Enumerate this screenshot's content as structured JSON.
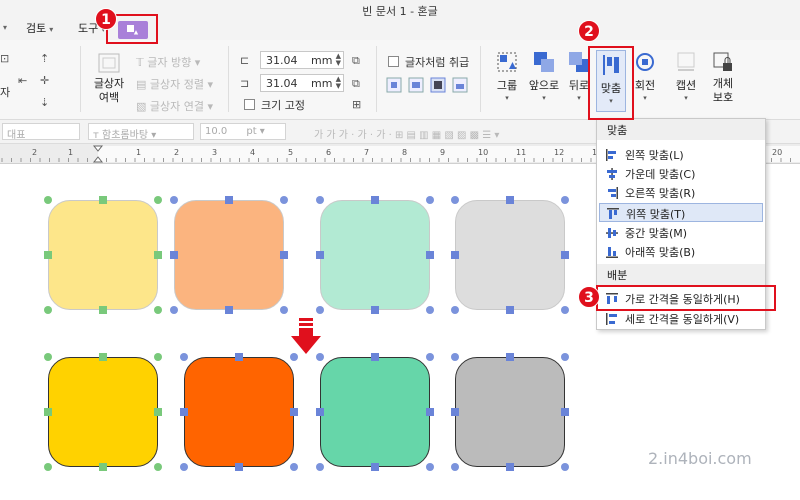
{
  "window": {
    "title": "빈 문서 1 - 혼글"
  },
  "menubar": {
    "items": [
      "검토",
      "도구"
    ]
  },
  "ribbon": {
    "text_box_margin": "글상자\n여백",
    "text_direction": "글자 방향",
    "text_box_align": "글상자 정렬",
    "text_box_link": "글상자 연결",
    "width": {
      "value": "31.04",
      "unit": "mm"
    },
    "height": {
      "value": "31.04",
      "unit": "mm"
    },
    "treat_as_char": "글자처럼 취급",
    "fix_size": "크기 고정",
    "group": "그룹",
    "bring_front": "앞으로",
    "send_back": "뒤로",
    "align": "맞춤",
    "rotate": "회전",
    "caption": "캡션",
    "protect": "개체\n보호"
  },
  "toolbar2": {
    "style": "대표",
    "font": "함초롬바탕",
    "size": "10.0",
    "size_unit": "pt"
  },
  "ruler": {
    "labels": [
      "2",
      "1",
      "1",
      "2",
      "3",
      "4",
      "5",
      "6",
      "7",
      "8",
      "9",
      "10",
      "11",
      "12",
      "13",
      "14",
      "15",
      "16",
      "17",
      "20"
    ]
  },
  "dropdown": {
    "align_header": "맞춤",
    "align_items": [
      "왼쪽 맞춤(L)",
      "가운데 맞춤(C)",
      "오른쪽 맞춤(R)",
      "위쪽 맞춤(T)",
      "중간 맞춤(M)",
      "아래쪽 맞춤(B)"
    ],
    "distribute_header": "배분",
    "distribute_items": [
      "가로 간격을 동일하게(H)",
      "세로 간격을 동일하게(V)"
    ]
  },
  "badges": [
    "1",
    "2",
    "3"
  ],
  "watermark": "2.in4boi.com",
  "colors": {
    "before": [
      "#fde68a",
      "#fbb47f",
      "#b2ead3",
      "#dddddd"
    ],
    "after": [
      "#ffd200",
      "#ff6400",
      "#66d6a9",
      "#bbbbbb"
    ],
    "highlight": "#e0101d",
    "context_tab": "#a980d9"
  }
}
